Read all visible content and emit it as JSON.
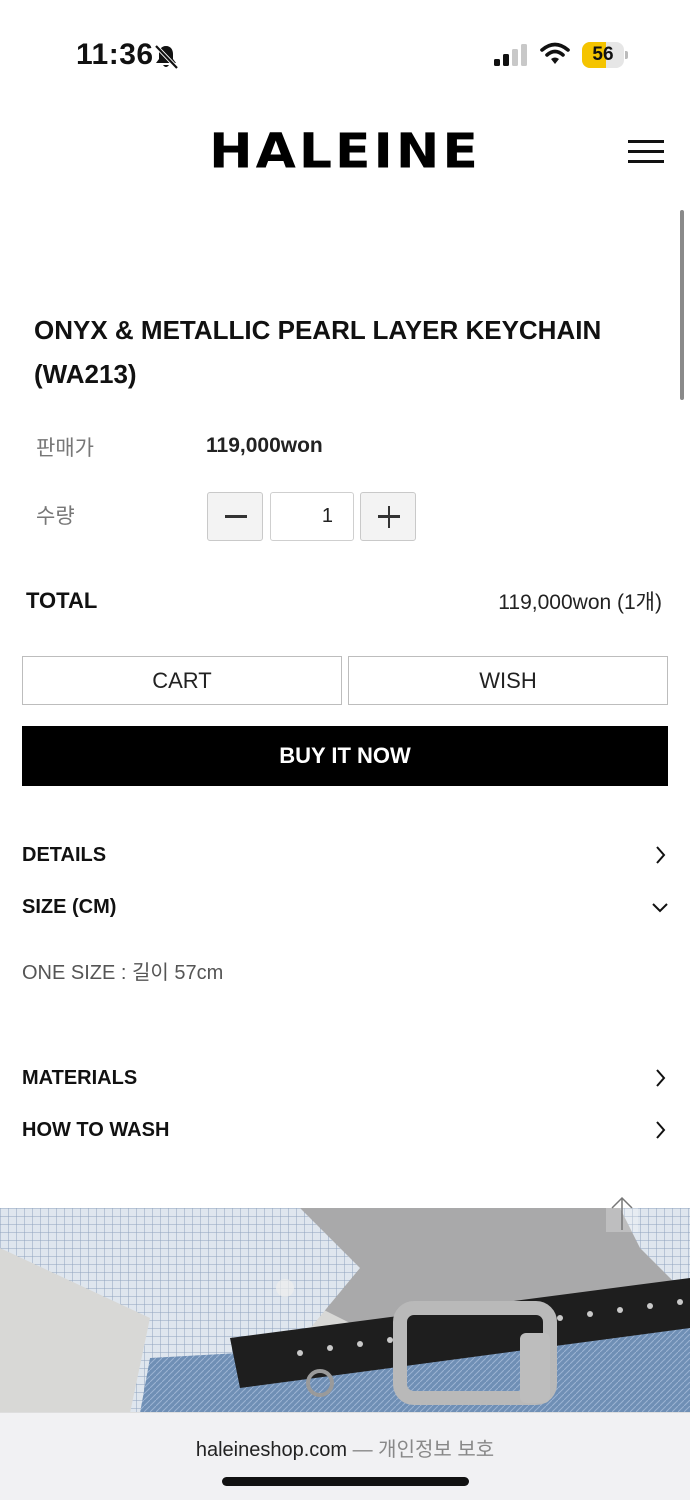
{
  "status_bar": {
    "time": "11:36",
    "battery_level": "56",
    "battery_color": "#f5c400",
    "icons": [
      "bell-slash-icon",
      "cellular-signal-icon",
      "wifi-icon",
      "battery-icon"
    ]
  },
  "header": {
    "logo": "HALEINE",
    "menu_icon": "hamburger-menu-icon"
  },
  "product": {
    "title": "ONYX & METALLIC PEARL LAYER KEYCHAIN (WA213)",
    "price_label": "판매가",
    "price": "119,000won",
    "quantity_label": "수량",
    "quantity": "1"
  },
  "total": {
    "label": "TOTAL",
    "value": "119,000won (1개)"
  },
  "actions": {
    "cart": "CART",
    "wish": "WISH",
    "buy": "BUY IT NOW"
  },
  "accordion": {
    "details": "DETAILS",
    "size": "SIZE (CM)",
    "size_content": "ONE SIZE : 길이 57cm",
    "materials": "MATERIALS",
    "how_to_wash": "HOW TO WASH"
  },
  "browser": {
    "domain": "haleineshop.com",
    "privacy": "— 개인정보 보호"
  },
  "colors": {
    "buy_button": "#000000",
    "text": "#111111",
    "muted": "#777777"
  }
}
